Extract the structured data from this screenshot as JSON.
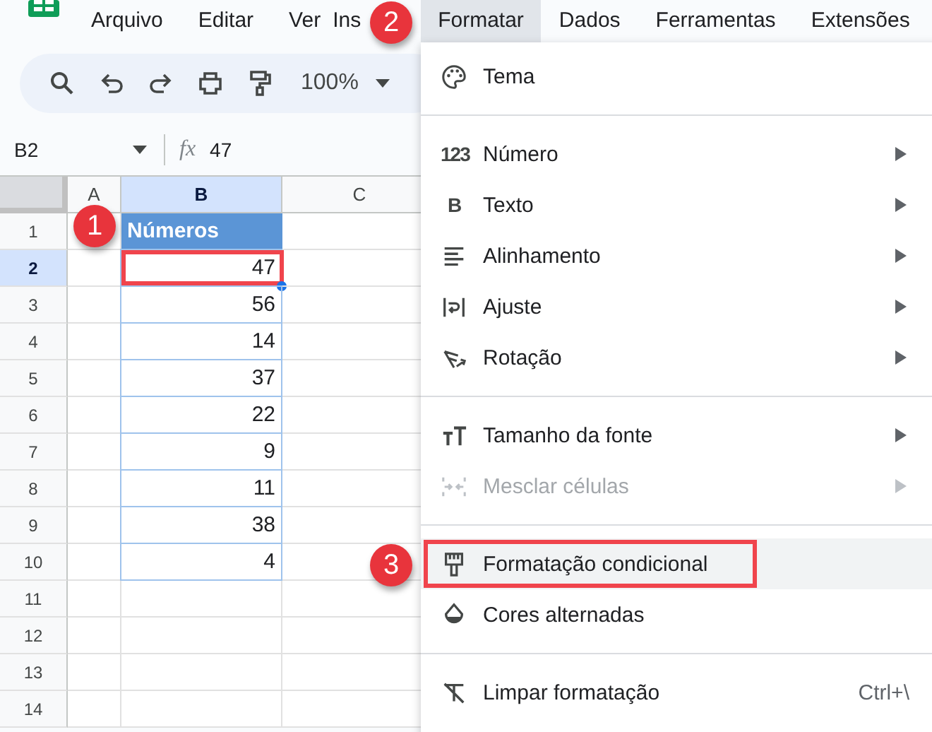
{
  "menubar": [
    {
      "label": "Arquivo",
      "selected": false
    },
    {
      "label": "Editar",
      "selected": false
    },
    {
      "label": "Ver",
      "selected": false
    },
    {
      "label": "Ins",
      "selected": false
    },
    {
      "label": "Formatar",
      "selected": true
    },
    {
      "label": "Dados",
      "selected": false
    },
    {
      "label": "Ferramentas",
      "selected": false
    },
    {
      "label": "Extensões",
      "selected": false
    }
  ],
  "toolbar": {
    "zoom": "100%"
  },
  "formula_bar": {
    "cell_ref": "B2",
    "function_label": "fx",
    "value": "47"
  },
  "columns": [
    {
      "label": "A",
      "selected": false
    },
    {
      "label": "B",
      "selected": true
    },
    {
      "label": "C",
      "selected": false
    }
  ],
  "rows": [
    {
      "label": "1",
      "selected": false,
      "kind": "header",
      "column_b": "Números",
      "framed": false
    },
    {
      "label": "2",
      "selected": true,
      "kind": "value",
      "column_b": "47",
      "framed": true
    },
    {
      "label": "3",
      "selected": false,
      "kind": "value",
      "column_b": "56",
      "framed": false
    },
    {
      "label": "4",
      "selected": false,
      "kind": "value",
      "column_b": "14",
      "framed": false
    },
    {
      "label": "5",
      "selected": false,
      "kind": "value",
      "column_b": "37",
      "framed": false
    },
    {
      "label": "6",
      "selected": false,
      "kind": "value",
      "column_b": "22",
      "framed": false
    },
    {
      "label": "7",
      "selected": false,
      "kind": "value",
      "column_b": "9",
      "framed": false
    },
    {
      "label": "8",
      "selected": false,
      "kind": "value",
      "column_b": "11",
      "framed": false
    },
    {
      "label": "9",
      "selected": false,
      "kind": "value",
      "column_b": "38",
      "framed": false
    },
    {
      "label": "10",
      "selected": false,
      "kind": "value",
      "column_b": "4",
      "framed": false
    },
    {
      "label": "11",
      "selected": false,
      "kind": "empty",
      "framed": false
    },
    {
      "label": "12",
      "selected": false,
      "kind": "empty",
      "framed": false
    },
    {
      "label": "13",
      "selected": false,
      "kind": "empty",
      "framed": false
    },
    {
      "label": "14",
      "selected": false,
      "kind": "empty",
      "framed": false
    }
  ],
  "menu": {
    "items": [
      {
        "kind": "item",
        "label": "Tema",
        "submenu": false,
        "disabled": false,
        "highlighted": false,
        "framed": false
      },
      {
        "kind": "separator"
      },
      {
        "kind": "item",
        "label": "Número",
        "icon_text": "123",
        "submenu": true,
        "disabled": false,
        "highlighted": false,
        "framed": false
      },
      {
        "kind": "item",
        "label": "Texto",
        "icon_text": "B",
        "submenu": true,
        "disabled": false,
        "highlighted": false,
        "framed": false
      },
      {
        "kind": "item",
        "label": "Alinhamento",
        "submenu": true,
        "disabled": false,
        "highlighted": false,
        "framed": false
      },
      {
        "kind": "item",
        "label": "Ajuste",
        "submenu": true,
        "disabled": false,
        "highlighted": false,
        "framed": false
      },
      {
        "kind": "item",
        "label": "Rotação",
        "submenu": true,
        "disabled": false,
        "highlighted": false,
        "framed": false
      },
      {
        "kind": "separator"
      },
      {
        "kind": "item",
        "label": "Tamanho da fonte",
        "submenu": true,
        "disabled": false,
        "highlighted": false,
        "framed": false
      },
      {
        "kind": "item",
        "label": "Mesclar células",
        "submenu": true,
        "disabled": true,
        "highlighted": false,
        "framed": false
      },
      {
        "kind": "separator"
      },
      {
        "kind": "item",
        "label": "Formatação condicional",
        "submenu": false,
        "disabled": false,
        "highlighted": true,
        "framed": true
      },
      {
        "kind": "item",
        "label": "Cores alternadas",
        "submenu": false,
        "disabled": false,
        "highlighted": false,
        "framed": false
      },
      {
        "kind": "separator"
      },
      {
        "kind": "item",
        "label": "Limpar formatação",
        "shortcut": "Ctrl+\\",
        "submenu": false,
        "disabled": false,
        "highlighted": false,
        "framed": false
      }
    ]
  },
  "callouts": [
    {
      "label": "1"
    },
    {
      "label": "2"
    },
    {
      "label": "3"
    }
  ]
}
